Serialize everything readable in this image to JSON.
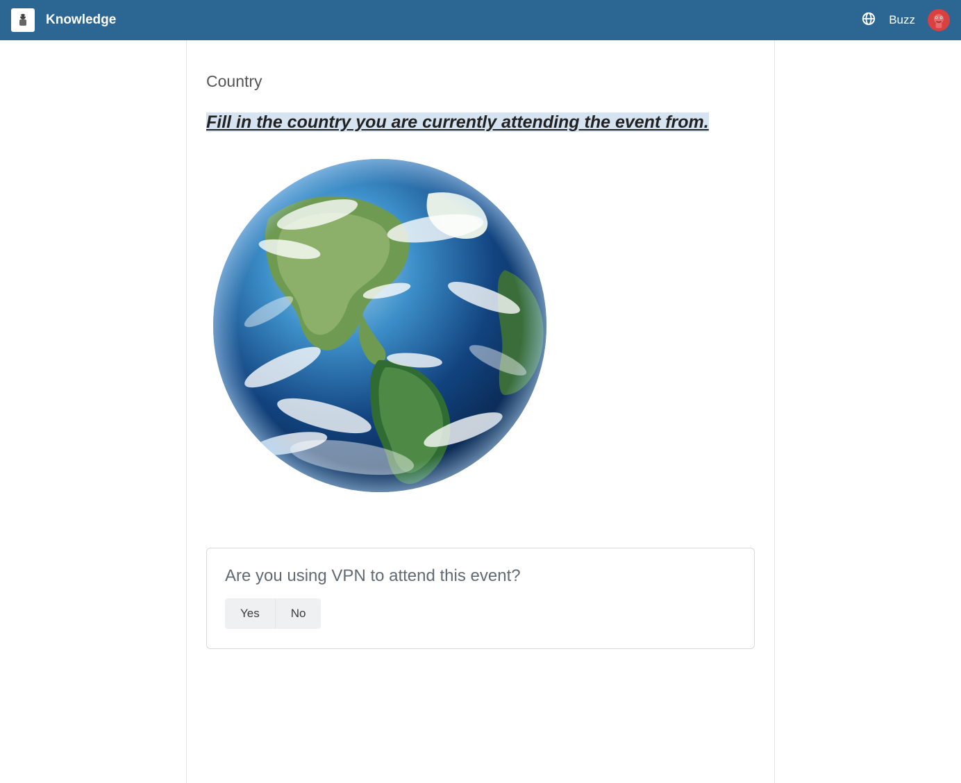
{
  "navbar": {
    "brand": "Knowledge",
    "username": "Buzz"
  },
  "main": {
    "section_title": "Country",
    "instruction": "Fill in the country you are currently attending the event from.",
    "image_alt": "earth-globe"
  },
  "vpn_card": {
    "question": "Are you using VPN to attend this event?",
    "yes_label": "Yes",
    "no_label": "No"
  },
  "colors": {
    "navbar_bg": "#2c6693",
    "highlight_bg": "#d6e4f2"
  }
}
